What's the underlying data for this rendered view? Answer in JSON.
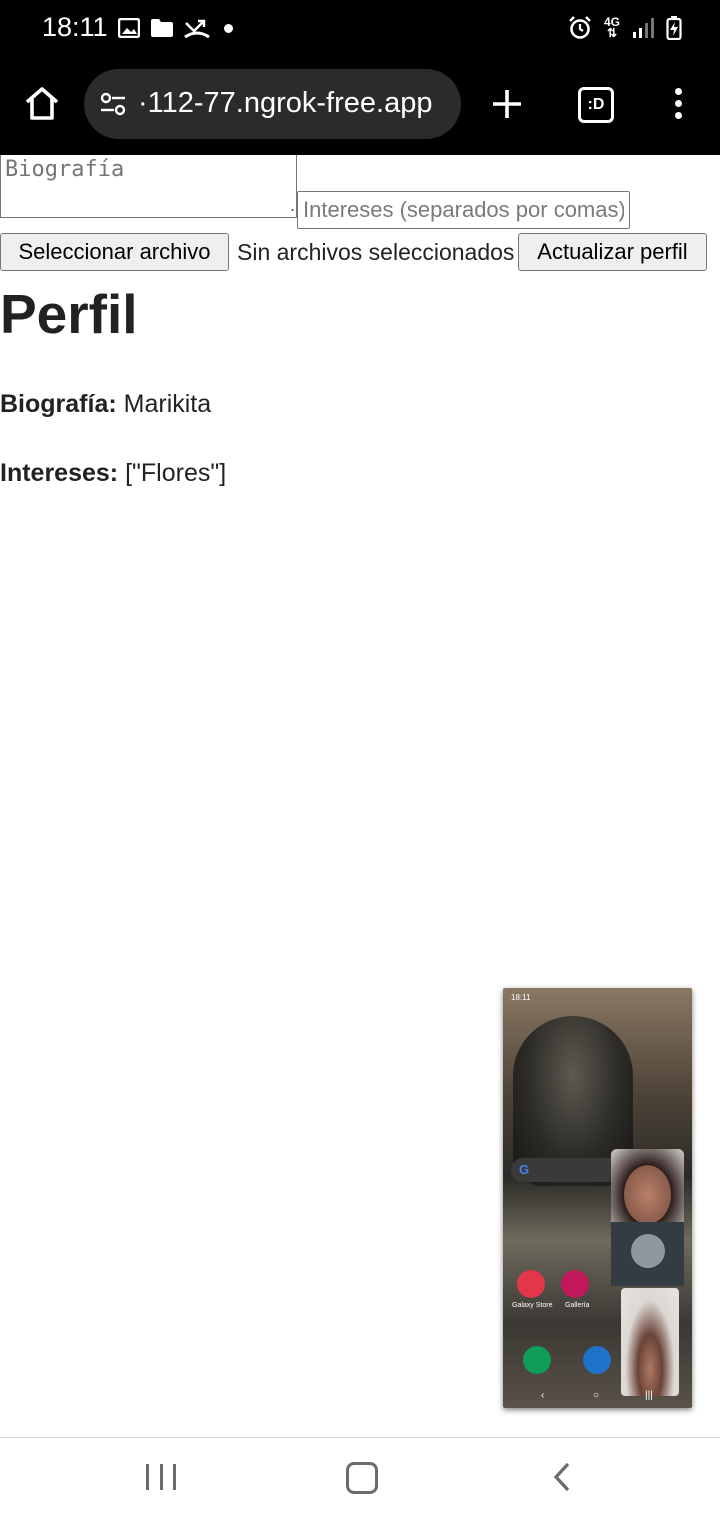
{
  "status_bar": {
    "time": "18:11",
    "left_icons": [
      "gallery-icon",
      "folder-icon",
      "missed-call-icon",
      "dot-icon"
    ],
    "right_icons": [
      "alarm-icon",
      "4g-data-icon",
      "signal-icon",
      "battery-charging-icon"
    ],
    "network_label": "4G"
  },
  "browser": {
    "url": "·112-77.ngrok-free.app",
    "tab_switcher_label": ":D"
  },
  "form": {
    "bio_placeholder": "Biografía",
    "interests_placeholder": "Intereses (separados por comas)",
    "file_button_label": "Seleccionar archivo",
    "file_status": "Sin archivos seleccionados",
    "update_button_label": "Actualizar perfil"
  },
  "profile": {
    "title": "Perfil",
    "bio_label": "Biografía:",
    "bio_value": "Marikita",
    "interests_label": "Intereses:",
    "interests_value": "[\"Flores\"]"
  },
  "pip": {
    "status_time": "18:11",
    "app_labels": [
      "Galaxy Store",
      "Gallería"
    ]
  },
  "colors": {
    "system_bar_bg": "#000000",
    "url_bar_bg": "#2b2b2b",
    "button_bg": "#efefef",
    "text": "#222222"
  }
}
